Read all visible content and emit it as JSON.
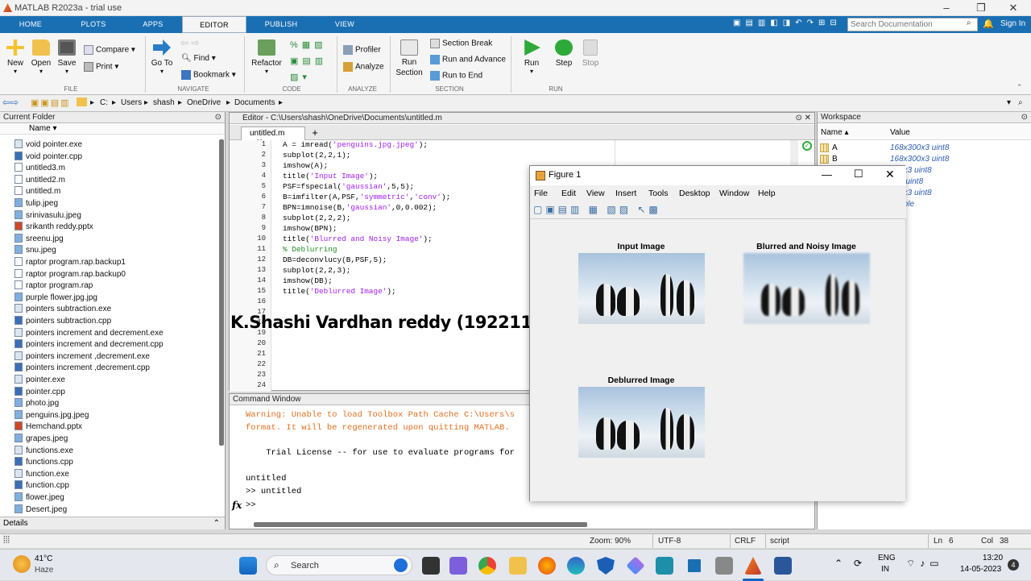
{
  "window": {
    "title": "MATLAB R2023a - trial use"
  },
  "ribbon_tabs": [
    "HOME",
    "PLOTS",
    "APPS",
    "EDITOR",
    "PUBLISH",
    "VIEW"
  ],
  "search": {
    "placeholder": "Search Documentation"
  },
  "signin": "Sign In",
  "ribbon": {
    "file": {
      "section": "FILE",
      "new": "New",
      "open": "Open",
      "save": "Save",
      "compare": "Compare",
      "print": "Print"
    },
    "navigate": {
      "section": "NAVIGATE",
      "goto": "Go To",
      "find": "Find",
      "bookmark": "Bookmark"
    },
    "code": {
      "section": "CODE",
      "refactor": "Refactor"
    },
    "analyze": {
      "section": "ANALYZE",
      "profiler": "Profiler",
      "analyze": "Analyze"
    },
    "section": {
      "section": "SECTION",
      "run_section": "Run\nSection",
      "section_break": "Section Break",
      "run_advance": "Run and Advance",
      "run_to_end": "Run to End"
    },
    "run": {
      "section": "RUN",
      "run": "Run",
      "step": "Step",
      "stop": "Stop"
    }
  },
  "address": [
    "C:",
    "Users",
    "shash",
    "OneDrive",
    "Documents"
  ],
  "current_folder": {
    "title": "Current Folder",
    "name_col": "Name",
    "files": [
      {
        "name": "void pointer.exe",
        "type": "exe"
      },
      {
        "name": "void pointer.cpp",
        "type": "cpp"
      },
      {
        "name": "untitled3.m",
        "type": "m"
      },
      {
        "name": "untitled2.m",
        "type": "m"
      },
      {
        "name": "untitled.m",
        "type": "m"
      },
      {
        "name": "tulip.jpeg",
        "type": "img"
      },
      {
        "name": "srinivasulu.jpeg",
        "type": "img"
      },
      {
        "name": "srikanth reddy.pptx",
        "type": "ppt"
      },
      {
        "name": "sreenu.jpg",
        "type": "img"
      },
      {
        "name": "snu.jpeg",
        "type": "img"
      },
      {
        "name": "raptor program.rap.backup1",
        "type": "doc"
      },
      {
        "name": "raptor program.rap.backup0",
        "type": "doc"
      },
      {
        "name": "raptor program.rap",
        "type": "rap"
      },
      {
        "name": "purple flower.jpg.jpg",
        "type": "img"
      },
      {
        "name": "pointers subtraction.exe",
        "type": "exe"
      },
      {
        "name": "pointers subtraction.cpp",
        "type": "cpp"
      },
      {
        "name": "pointers increment and decrement.exe",
        "type": "exe"
      },
      {
        "name": "pointers increment and decrement.cpp",
        "type": "cpp"
      },
      {
        "name": "pointers increment ,decrement.exe",
        "type": "exe"
      },
      {
        "name": "pointers increment ,decrement.cpp",
        "type": "cpp"
      },
      {
        "name": "pointer.exe",
        "type": "exe"
      },
      {
        "name": "pointer.cpp",
        "type": "cpp"
      },
      {
        "name": "photo.jpg",
        "type": "img"
      },
      {
        "name": "penguins.jpg.jpeg",
        "type": "img"
      },
      {
        "name": "Hemchand.pptx",
        "type": "ppt"
      },
      {
        "name": "grapes.jpeg",
        "type": "img"
      },
      {
        "name": "functions.exe",
        "type": "exe"
      },
      {
        "name": "functions.cpp",
        "type": "cpp"
      },
      {
        "name": "function.exe",
        "type": "exe"
      },
      {
        "name": "function.cpp",
        "type": "cpp"
      },
      {
        "name": "flower.jpeg",
        "type": "img"
      },
      {
        "name": "Desert.jpeg",
        "type": "img"
      }
    ],
    "details": "Details"
  },
  "editor": {
    "title": "Editor - C:\\Users\\shash\\OneDrive\\Documents\\untitled.m",
    "tab": "untitled.m",
    "lines": [
      [
        {
          "t": "A = imread(",
          "c": ""
        },
        {
          "t": "'penguins.jpg.jpeg'",
          "c": "str"
        },
        {
          "t": ");",
          "c": ""
        }
      ],
      [
        {
          "t": "subplot(2,2,1);",
          "c": ""
        }
      ],
      [
        {
          "t": "imshow(A);",
          "c": ""
        }
      ],
      [
        {
          "t": "title(",
          "c": ""
        },
        {
          "t": "'Input Image'",
          "c": "str"
        },
        {
          "t": ");",
          "c": ""
        }
      ],
      [
        {
          "t": "PSF=fspecial(",
          "c": ""
        },
        {
          "t": "'gaussian'",
          "c": "str"
        },
        {
          "t": ",5,5);",
          "c": ""
        }
      ],
      [
        {
          "t": "B=imfilter(A,PSF,",
          "c": ""
        },
        {
          "t": "'symmetric'",
          "c": "str"
        },
        {
          "t": ",",
          "c": ""
        },
        {
          "t": "'conv'",
          "c": "str"
        },
        {
          "t": ");",
          "c": ""
        }
      ],
      [
        {
          "t": "BPN=imnoise(B,",
          "c": ""
        },
        {
          "t": "'gaussian'",
          "c": "str"
        },
        {
          "t": ",0,0.002);",
          "c": ""
        }
      ],
      [
        {
          "t": "subplot(2,2,2);",
          "c": ""
        }
      ],
      [
        {
          "t": "imshow(BPN);",
          "c": ""
        }
      ],
      [
        {
          "t": "title(",
          "c": ""
        },
        {
          "t": "'Blurred and Noisy Image'",
          "c": "str"
        },
        {
          "t": ");",
          "c": ""
        }
      ],
      [
        {
          "t": "% Deblurring",
          "c": "cmt"
        }
      ],
      [
        {
          "t": "DB=deconvlucy(B,PSF,5);",
          "c": ""
        }
      ],
      [
        {
          "t": "subplot(2,2,3);",
          "c": ""
        }
      ],
      [
        {
          "t": "imshow(DB);",
          "c": ""
        }
      ],
      [
        {
          "t": "title(",
          "c": ""
        },
        {
          "t": "'Deblurred Image'",
          "c": "str"
        },
        {
          "t": ");",
          "c": ""
        }
      ]
    ],
    "line_numbers": [
      "1",
      "2",
      "3",
      "4",
      "5",
      "6",
      "7",
      "8",
      "9",
      "10",
      "11",
      "12",
      "13",
      "14",
      "15",
      "16",
      "17",
      "18",
      "19",
      "20",
      "21",
      "22",
      "23",
      "24"
    ]
  },
  "watermark": "K.Shashi Vardhan reddy (192211796)",
  "command_window": {
    "title": "Command Window",
    "lines": [
      {
        "t": "Warning: Unable to load Toolbox Path Cache C:\\Users\\s",
        "c": "warn"
      },
      {
        "t": "format. It will be regenerated upon quitting MATLAB.",
        "c": "warn"
      },
      {
        "t": "",
        "c": ""
      },
      {
        "t": "    Trial License -- for use to evaluate programs for",
        "c": ""
      },
      {
        "t": "",
        "c": ""
      },
      {
        "t": "untitled",
        "c": ""
      },
      {
        "t": ">> untitled",
        "c": ""
      }
    ],
    "prompt": ">>",
    "fx": "fx"
  },
  "workspace": {
    "title": "Workspace",
    "col_name": "Name",
    "col_value": "Value",
    "vars": [
      {
        "name": "A",
        "value": "168x300x3 uint8"
      },
      {
        "name": "B",
        "value": "168x300x3 uint8"
      },
      {
        "name": "",
        "value": "300x3 uint8"
      },
      {
        "name": "",
        "value": "300 uint8"
      },
      {
        "name": "",
        "value": "300x3 uint8"
      },
      {
        "name": "",
        "value": "double"
      }
    ]
  },
  "figure": {
    "title": "Figure 1",
    "menu": [
      "File",
      "Edit",
      "View",
      "Insert",
      "Tools",
      "Desktop",
      "Window",
      "Help"
    ],
    "subplots": [
      "Input Image",
      "Blurred and Noisy Image",
      "Deblurred Image"
    ]
  },
  "statusbar": {
    "zoom": "Zoom: 90%",
    "encoding": "UTF-8",
    "eol": "CRLF",
    "mode": "script",
    "ln": "Ln",
    "ln_val": "6",
    "col": "Col",
    "col_val": "38"
  },
  "taskbar": {
    "weather_temp": "41°C",
    "weather_text": "Haze",
    "search": "Search",
    "lang1": "ENG",
    "lang2": "IN",
    "time": "13:20",
    "date": "14-05-2023",
    "badge": "4"
  }
}
